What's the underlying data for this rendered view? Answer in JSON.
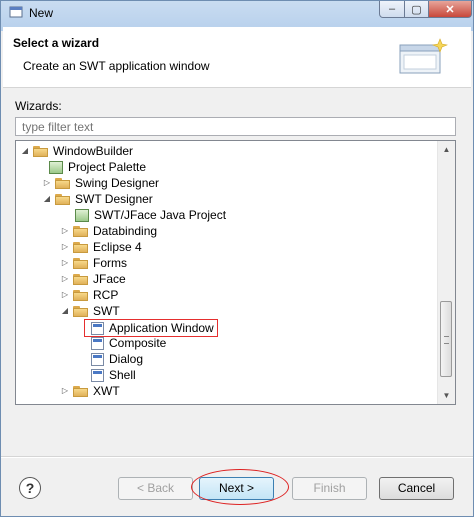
{
  "window": {
    "title": "New",
    "min_glyph": "–",
    "max_glyph": "▢",
    "close_glyph": "✕"
  },
  "header": {
    "title": "Select a wizard",
    "description": "Create an SWT application window"
  },
  "wizards_label": "Wizards:",
  "filter": {
    "value": "",
    "placeholder": "type filter text"
  },
  "tree": {
    "items": [
      {
        "label": "WindowBuilder",
        "expander": "◢",
        "icon": "folder-icon"
      },
      {
        "label": "Project Palette",
        "expander": "",
        "icon": "palette-icon"
      },
      {
        "label": "Swing Designer",
        "expander": "▷",
        "icon": "folder-icon"
      },
      {
        "label": "SWT Designer",
        "expander": "◢",
        "icon": "folder-icon"
      },
      {
        "label": "SWT/JFace Java Project",
        "expander": "",
        "icon": "project-icon"
      },
      {
        "label": "Databinding",
        "expander": "▷",
        "icon": "folder-icon"
      },
      {
        "label": "Eclipse 4",
        "expander": "▷",
        "icon": "folder-icon"
      },
      {
        "label": "Forms",
        "expander": "▷",
        "icon": "folder-icon"
      },
      {
        "label": "JFace",
        "expander": "▷",
        "icon": "folder-icon"
      },
      {
        "label": "RCP",
        "expander": "▷",
        "icon": "folder-icon"
      },
      {
        "label": "SWT",
        "expander": "◢",
        "icon": "folder-icon"
      },
      {
        "label": "Application Window",
        "expander": "",
        "icon": "window-file-icon",
        "selected": true
      },
      {
        "label": "Composite",
        "expander": "",
        "icon": "window-file-icon"
      },
      {
        "label": "Dialog",
        "expander": "",
        "icon": "window-file-icon"
      },
      {
        "label": "Shell",
        "expander": "",
        "icon": "window-file-icon"
      },
      {
        "label": "XWT",
        "expander": "▷",
        "icon": "folder-icon"
      }
    ],
    "scroll_up": "▲",
    "scroll_down": "▼"
  },
  "buttons": {
    "help": "?",
    "back": "< Back",
    "next": "Next >",
    "finish": "Finish",
    "cancel": "Cancel"
  },
  "colors": {
    "highlight": "#e52e2e",
    "title_bar": "#b7d0ec"
  }
}
